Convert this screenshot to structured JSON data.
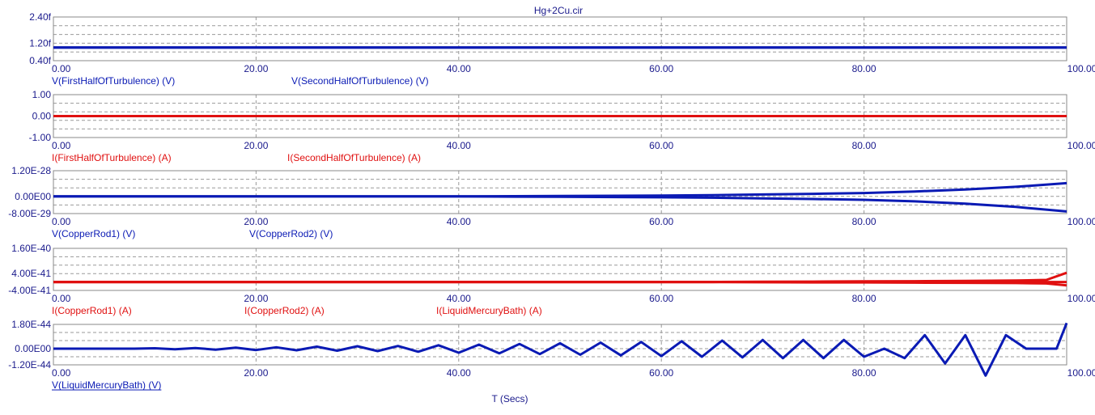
{
  "colors": {
    "blue": "#0a1ab4",
    "red": "#e01010",
    "axis_text": "#1a1a8c",
    "title_text": "#1a1a8c"
  },
  "chart_data": {
    "type": "line",
    "title": "Hg+2Cu.cir",
    "xlabel": "T (Secs)",
    "xlim": [
      0,
      100
    ],
    "x_tick_labels": [
      "0.00",
      "20.00",
      "40.00",
      "60.00",
      "80.00",
      "100.00"
    ],
    "panels": [
      {
        "ylim": [
          0.4,
          2.4
        ],
        "y_tick_labels": [
          "2.40f",
          "1.20f",
          "0.40f"
        ],
        "series": [
          {
            "name": "V(FirstHalfOfTurbulence) (V)",
            "color": "blue",
            "x": [
              0,
              100
            ],
            "y": [
              1.0,
              1.0
            ]
          },
          {
            "name": "V(SecondHalfOfTurbulence) (V)",
            "color": "blue",
            "x": [
              0,
              100
            ],
            "y": [
              1.0,
              1.0
            ]
          }
        ]
      },
      {
        "ylim": [
          -1.0,
          1.0
        ],
        "y_tick_labels": [
          "1.00",
          "0.00",
          "-1.00"
        ],
        "series": [
          {
            "name": "I(FirstHalfOfTurbulence) (A)",
            "color": "red",
            "x": [
              0,
              100
            ],
            "y": [
              0,
              0
            ]
          },
          {
            "name": "I(SecondHalfOfTurbulence) (A)",
            "color": "red",
            "x": [
              0,
              100
            ],
            "y": [
              0,
              0
            ]
          }
        ]
      },
      {
        "ylim": [
          -8e-29,
          1.2e-28
        ],
        "y_tick_labels": [
          "1.20E-28",
          "0.00E00",
          "-8.00E-29"
        ],
        "series": [
          {
            "name": "V(CopperRod1) (V)",
            "color": "blue",
            "x": [
              0,
              10,
              20,
              30,
              40,
              50,
              60,
              65,
              70,
              75,
              80,
              85,
              90,
              95,
              100
            ],
            "y": [
              0,
              0,
              0,
              0,
              0,
              2e-30,
              4e-30,
              6e-30,
              9e-30,
              1.2e-29,
              1.6e-29,
              2.3e-29,
              3.2e-29,
              4.5e-29,
              6.2e-29
            ]
          },
          {
            "name": "V(CopperRod2) (V)",
            "color": "blue",
            "x": [
              0,
              10,
              20,
              30,
              40,
              50,
              60,
              65,
              70,
              75,
              80,
              85,
              90,
              95,
              100
            ],
            "y": [
              0,
              0,
              0,
              0,
              0,
              -2e-30,
              -4e-30,
              -6e-30,
              -9e-30,
              -1.2e-29,
              -1.6e-29,
              -2.3e-29,
              -3.4e-29,
              -4.9e-29,
              -7e-29
            ]
          }
        ]
      },
      {
        "ylim": [
          -4e-41,
          1.6e-40
        ],
        "y_tick_labels": [
          "1.60E-40",
          "4.00E-41",
          "-4.00E-41"
        ],
        "series": [
          {
            "name": "I(CopperRod1) (A)",
            "color": "red",
            "x": [
              0,
              65,
              70,
              75,
              80,
              85,
              90,
              95,
              98,
              100
            ],
            "y": [
              0,
              0,
              1e-42,
              2e-42,
              3e-42,
              4e-42,
              5e-42,
              7e-42,
              1e-41,
              4.4e-41
            ]
          },
          {
            "name": "I(CopperRod2) (A)",
            "color": "red",
            "x": [
              0,
              65,
              70,
              75,
              80,
              85,
              90,
              95,
              98,
              100
            ],
            "y": [
              0,
              0,
              -1e-42,
              -2e-42,
              -2e-42,
              -3e-42,
              -4e-42,
              -5e-42,
              -7e-42,
              -1.6e-41
            ]
          },
          {
            "name": "I(LiquidMercuryBath) (A)",
            "color": "red",
            "x": [
              0,
              100
            ],
            "y": [
              0,
              0
            ]
          }
        ]
      },
      {
        "ylim": [
          -1.2e-44,
          1.8e-44
        ],
        "y_tick_labels": [
          "1.80E-44",
          "0.00E00",
          "-1.20E-44"
        ],
        "series": [
          {
            "name": "V(LiquidMercuryBath) (V)",
            "color": "blue",
            "x": [
              0,
              8,
              10,
              12,
              14,
              16,
              18,
              20,
              22,
              24,
              26,
              28,
              30,
              32,
              34,
              36,
              38,
              40,
              42,
              44,
              46,
              48,
              50,
              52,
              54,
              56,
              58,
              60,
              62,
              64,
              66,
              68,
              70,
              72,
              74,
              76,
              78,
              80,
              82,
              84,
              86,
              88,
              90,
              92,
              94,
              96,
              98,
              99,
              100
            ],
            "y": [
              0,
              0,
              3e-46,
              -5e-46,
              5e-46,
              -7e-46,
              8e-46,
              -1e-45,
              1e-45,
              -1.2e-45,
              1.5e-45,
              -1.5e-45,
              1.8e-45,
              -1.8e-45,
              2e-45,
              -2.3e-45,
              2.5e-45,
              -3e-45,
              3e-45,
              -3.5e-45,
              3.5e-45,
              -4e-45,
              4e-45,
              -4.5e-45,
              4.5e-45,
              -5e-45,
              5e-45,
              -5.5e-45,
              5.5e-45,
              -6e-45,
              6e-45,
              -6.5e-45,
              6.5e-45,
              -7e-45,
              6.5e-45,
              -7e-45,
              6.5e-45,
              -6e-45,
              0,
              -7e-45,
              1e-44,
              -1.1e-44,
              1e-44,
              -2e-44,
              1e-44,
              0,
              0,
              0,
              1.9e-44
            ]
          }
        ]
      }
    ]
  }
}
